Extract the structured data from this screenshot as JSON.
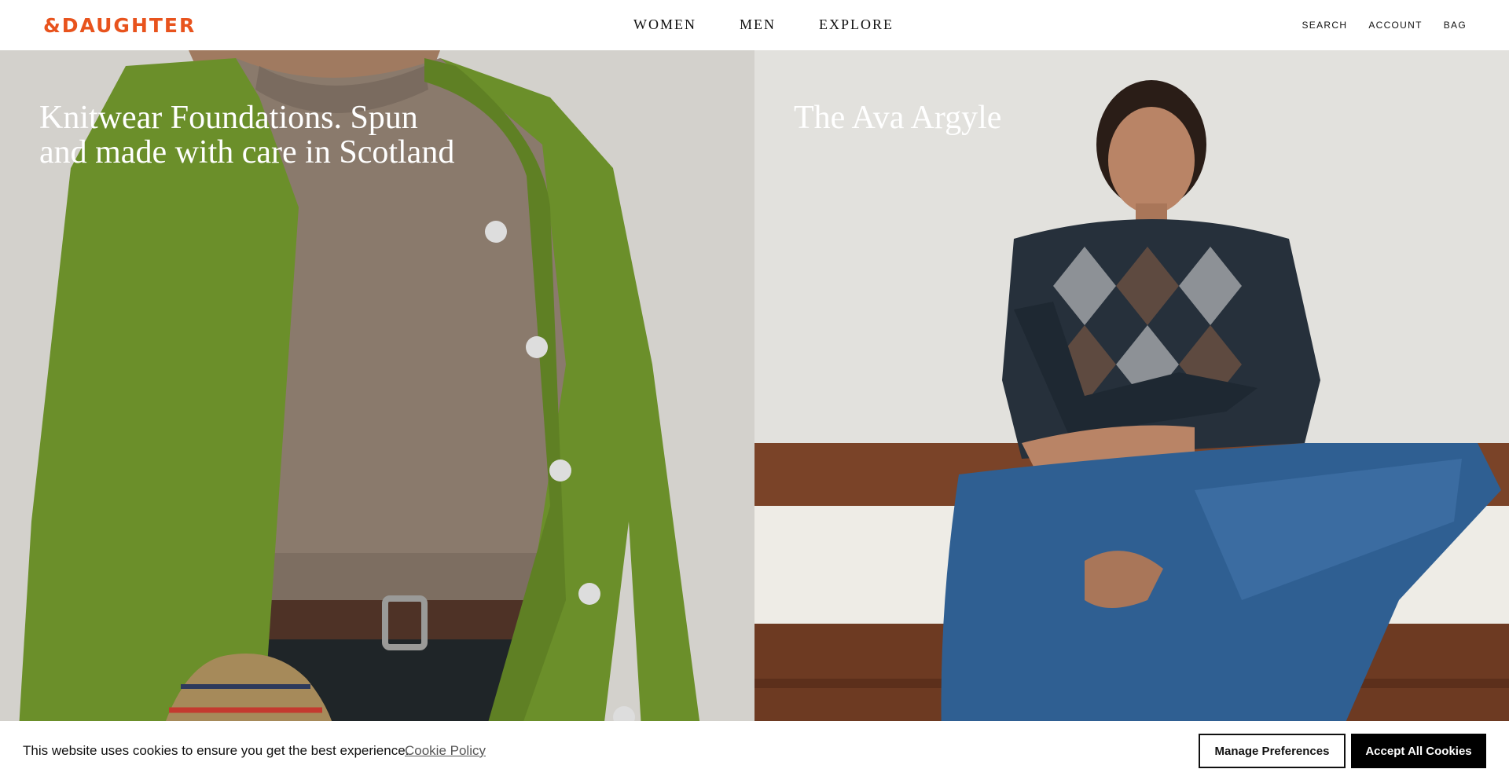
{
  "header": {
    "logo": "&DAUGHTER",
    "nav": [
      "WOMEN",
      "MEN",
      "EXPLORE"
    ],
    "utility": [
      "SEARCH",
      "ACCOUNT",
      "BAG"
    ]
  },
  "hero": {
    "left": {
      "title_line1": "Knitwear Foundations. Spun",
      "title_line2": "and made with care in Scotland"
    },
    "right": {
      "title": "The Ava Argyle"
    }
  },
  "cookie_banner": {
    "text": "This website uses cookies to ensure you get the best experience.",
    "policy_link": "Cookie Policy",
    "manage_button": "Manage Preferences",
    "accept_button": "Accept All Cookies"
  },
  "colors": {
    "brand": "#e8531d",
    "cardigan": "#6b8f2a",
    "sweater": "#8a7a6c",
    "denim": "#2f5f92"
  }
}
